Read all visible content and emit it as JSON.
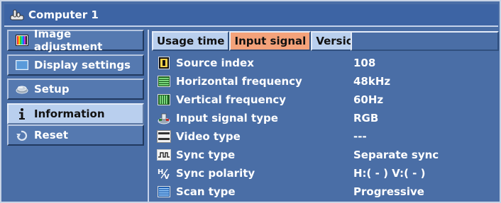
{
  "window": {
    "title": "Computer 1",
    "title_icon": "hand-cursor-icon"
  },
  "sidebar": {
    "items": [
      {
        "label": "Image adjustment",
        "icon": "image-adjustment-icon",
        "active": false
      },
      {
        "label": "Display settings",
        "icon": "display-settings-icon",
        "active": false
      },
      {
        "label": "Setup",
        "icon": "setup-icon",
        "active": false
      },
      {
        "label": "Information",
        "icon": "info-icon",
        "active": true
      },
      {
        "label": "Reset",
        "icon": "reset-icon",
        "active": false
      }
    ]
  },
  "tabs": [
    {
      "label": "Usage time",
      "active": false
    },
    {
      "label": "Input signal",
      "active": true
    },
    {
      "label": "Version",
      "active": false
    }
  ],
  "rows": [
    {
      "label": "Source index",
      "value": "108",
      "icon": "source-index-icon"
    },
    {
      "label": "Horizontal frequency",
      "value": "48kHz",
      "icon": "horizontal-frequency-icon"
    },
    {
      "label": "Vertical frequency",
      "value": "60Hz",
      "icon": "vertical-frequency-icon"
    },
    {
      "label": "Input signal type",
      "value": "RGB",
      "icon": "input-signal-type-icon"
    },
    {
      "label": "Video type",
      "value": "---",
      "icon": "ntsc-pal-icon"
    },
    {
      "label": "Sync type",
      "value": "Separate sync",
      "icon": "sync-type-icon"
    },
    {
      "label": "Sync polarity",
      "value": "H:( - ) V:( - )",
      "icon": "sync-polarity-icon"
    },
    {
      "label": "Scan type",
      "value": "Progressive",
      "icon": "scan-type-icon"
    }
  ],
  "colors": {
    "background": "#4a6ea6",
    "active_sidebar": "#b9cfee",
    "active_tab": "#f4a27a",
    "tab": "#b9cfee"
  }
}
